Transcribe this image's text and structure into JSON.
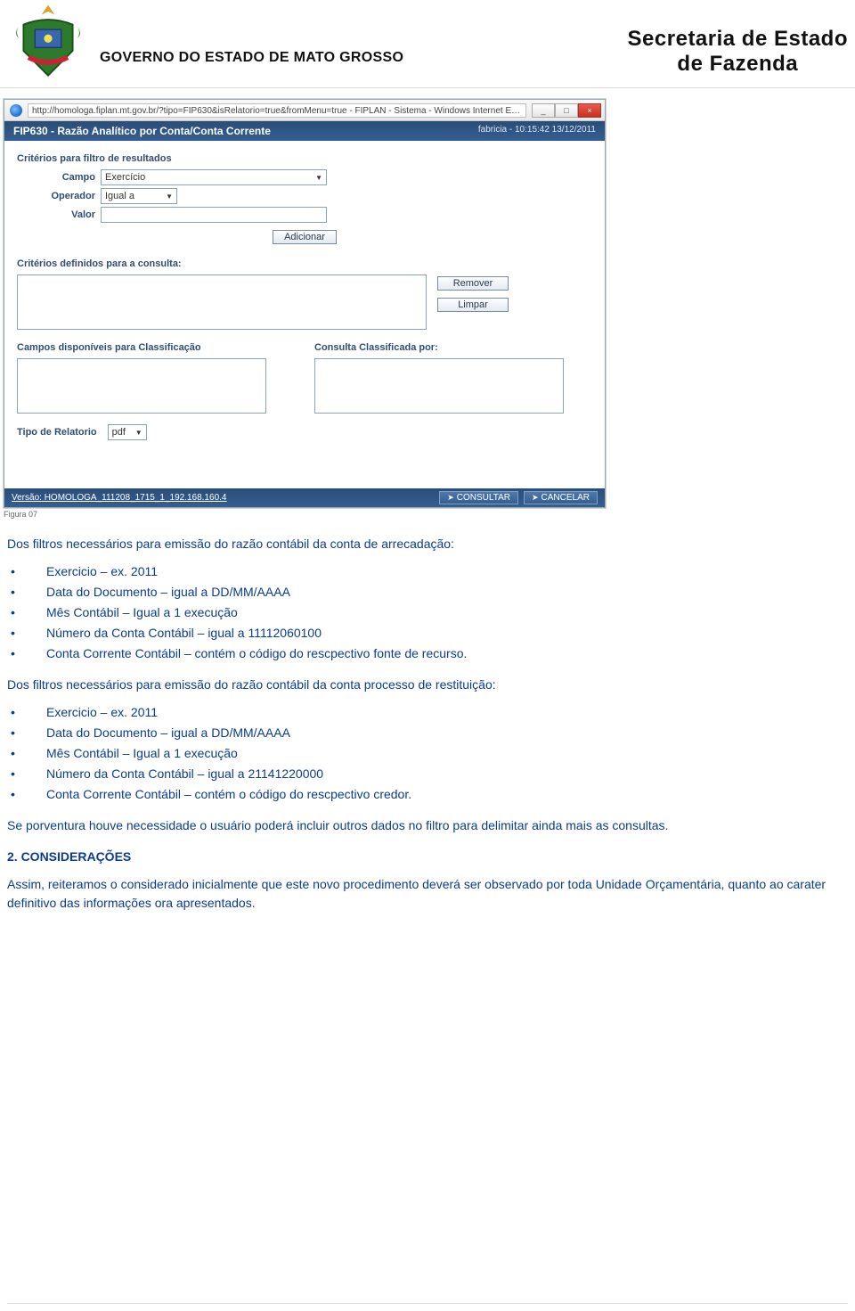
{
  "header": {
    "gov_text": "GOVERNO DO ESTADO DE MATO GROSSO",
    "sec_line1": "Secretaria de Estado",
    "sec_line2": "de Fazenda"
  },
  "window": {
    "url": "http://homologa.fiplan.mt.gov.br/?tipo=FIP630&isRelatorio=true&fromMenu=true - FIPLAN - Sistema - Windows Internet Ex...",
    "btn_min": "_",
    "btn_max": "□",
    "btn_close": "×"
  },
  "titlebar": {
    "title": "FIP630 - Razão Analítico por Conta/Conta Corrente",
    "meta": "fabricia - 10:15:42 13/12/2011"
  },
  "filters": {
    "section": "Critérios para filtro de resultados",
    "campo_label": "Campo",
    "campo_value": "Exercício",
    "operador_label": "Operador",
    "operador_value": "Igual a",
    "valor_label": "Valor",
    "valor_value": "",
    "adicionar": "Adicionar",
    "defined_label": "Critérios definidos para a consulta:",
    "remover": "Remover",
    "limpar": "Limpar",
    "campos_disp": "Campos disponíveis para Classificação",
    "consulta_class": "Consulta Classificada por:",
    "tipo_label": "Tipo de Relatorio",
    "tipo_value": "pdf"
  },
  "footer": {
    "version": "Versão: HOMOLOGA_111208_1715_1_192.168.160.4",
    "consultar": "CONSULTAR",
    "cancelar": "CANCELAR"
  },
  "figure_caption": "Figura 07",
  "doc": {
    "para1": "Dos filtros necessários para emissão do razão contábil da conta de arrecadação:",
    "list1": {
      "i0": "Exercicio – ex. 2011",
      "i1": "Data do Documento – igual a DD/MM/AAAA",
      "i2": "Mês Contábil – Igual a 1 execução",
      "i3": "Número da Conta Contábil – igual a 11112060100",
      "i4": "Conta Corrente Contábil – contém o código do rescpectivo fonte de recurso."
    },
    "para2": "Dos filtros necessários para emissão do razão contábil da conta processo de restituição:",
    "list2": {
      "i0": "Exercicio – ex. 2011",
      "i1": "Data do Documento – igual a DD/MM/AAAA",
      "i2": "Mês Contábil – Igual a 1 execução",
      "i3": "Número da Conta Contábil – igual a 21141220000",
      "i4": "Conta Corrente Contábil – contém o código do rescpectivo credor."
    },
    "para3": "Se porventura houve necessidade o usuário poderá incluir outros dados no filtro para delimitar ainda mais as consultas.",
    "h2": "2.     CONSIDERAÇÕES",
    "para4": "Assim, reiteramos o considerado inicialmente que este novo procedimento deverá ser observado por toda Unidade Orçamentária, quanto ao carater definitivo das informações ora apresentados."
  }
}
